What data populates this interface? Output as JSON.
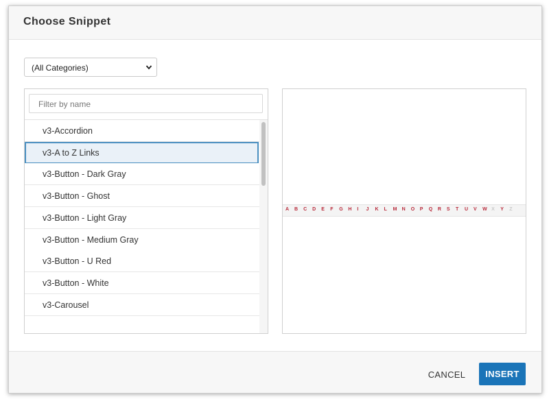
{
  "dialog": {
    "title": "Choose Snippet"
  },
  "category_select": {
    "selected": "(All Categories)",
    "icon": "chevron-down-icon"
  },
  "filter": {
    "placeholder": "Filter by name",
    "value": ""
  },
  "snippets": {
    "selected_index": 1,
    "items": [
      "v3-Accordion",
      "v3-A to Z Links",
      "v3-Button - Dark Gray",
      "v3-Button - Ghost",
      "v3-Button - Light Gray",
      "v3-Button - Medium Gray",
      "v3-Button - U Red",
      "v3-Button - White",
      "v3-Carousel"
    ]
  },
  "preview": {
    "letters": [
      "A",
      "B",
      "C",
      "D",
      "E",
      "F",
      "G",
      "H",
      "I",
      "J",
      "K",
      "L",
      "M",
      "N",
      "O",
      "P",
      "Q",
      "R",
      "S",
      "T",
      "U",
      "V",
      "W",
      "X",
      "Y",
      "Z"
    ],
    "disabled_letters": [
      "X",
      "Z"
    ],
    "link_color": "#b8293a",
    "disabled_color": "#c8c8c8"
  },
  "footer": {
    "cancel_label": "CANCEL",
    "insert_label": "INSERT"
  },
  "colors": {
    "accent": "#1a74b8",
    "selection_border": "#4a8fc0",
    "selection_bg": "#eaf1f8"
  }
}
